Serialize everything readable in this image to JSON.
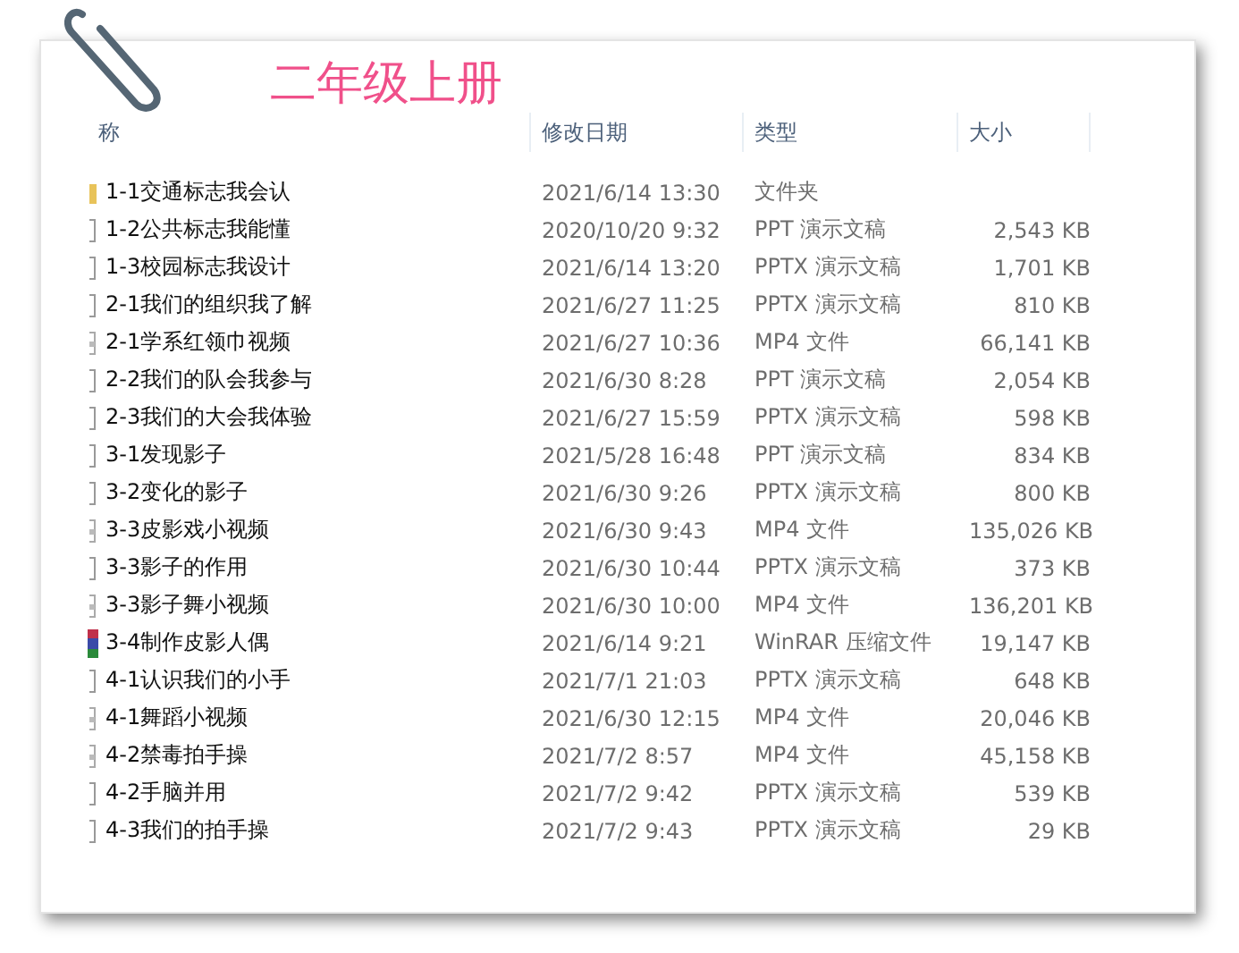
{
  "title": "二年级上册",
  "columns": [
    "称",
    "修改日期",
    "类型",
    "大小"
  ],
  "rows": [
    {
      "kind": "folder",
      "name": "1-1交通标志我会认",
      "date": "2021/6/14 13:30",
      "type": "文件夹",
      "size": ""
    },
    {
      "kind": "doc",
      "name": "1-2公共标志我能懂",
      "date": "2020/10/20 9:32",
      "type": "PPT 演示文稿",
      "size": "2,543 KB"
    },
    {
      "kind": "doc",
      "name": "1-3校园标志我设计",
      "date": "2021/6/14 13:20",
      "type": "PPTX 演示文稿",
      "size": "1,701 KB"
    },
    {
      "kind": "doc",
      "name": "2-1我们的组织我了解",
      "date": "2021/6/27 11:25",
      "type": "PPTX 演示文稿",
      "size": "810 KB"
    },
    {
      "kind": "video",
      "name": "2-1学系红领巾视频",
      "date": "2021/6/27 10:36",
      "type": "MP4 文件",
      "size": "66,141 KB"
    },
    {
      "kind": "doc",
      "name": "2-2我们的队会我参与",
      "date": "2021/6/30 8:28",
      "type": "PPT 演示文稿",
      "size": "2,054 KB"
    },
    {
      "kind": "doc",
      "name": "2-3我们的大会我体验",
      "date": "2021/6/27 15:59",
      "type": "PPTX 演示文稿",
      "size": "598 KB"
    },
    {
      "kind": "doc",
      "name": "3-1发现影子",
      "date": "2021/5/28 16:48",
      "type": "PPT 演示文稿",
      "size": "834 KB"
    },
    {
      "kind": "doc",
      "name": "3-2变化的影子",
      "date": "2021/6/30 9:26",
      "type": "PPTX 演示文稿",
      "size": "800 KB"
    },
    {
      "kind": "video",
      "name": "3-3皮影戏小视频",
      "date": "2021/6/30 9:43",
      "type": "MP4 文件",
      "size": "135,026 KB"
    },
    {
      "kind": "doc",
      "name": "3-3影子的作用",
      "date": "2021/6/30 10:44",
      "type": "PPTX 演示文稿",
      "size": "373 KB"
    },
    {
      "kind": "video",
      "name": "3-3影子舞小视频",
      "date": "2021/6/30 10:00",
      "type": "MP4 文件",
      "size": "136,201 KB"
    },
    {
      "kind": "archive",
      "name": "3-4制作皮影人偶",
      "date": "2021/6/14 9:21",
      "type": "WinRAR 压缩文件",
      "size": "19,147 KB"
    },
    {
      "kind": "doc",
      "name": "4-1认识我们的小手",
      "date": "2021/7/1 21:03",
      "type": "PPTX 演示文稿",
      "size": "648 KB"
    },
    {
      "kind": "video",
      "name": "4-1舞蹈小视频",
      "date": "2021/6/30 12:15",
      "type": "MP4 文件",
      "size": "20,046 KB"
    },
    {
      "kind": "video",
      "name": "4-2禁毒拍手操",
      "date": "2021/7/2 8:57",
      "type": "MP4 文件",
      "size": "45,158 KB"
    },
    {
      "kind": "doc",
      "name": "4-2手脑并用",
      "date": "2021/7/2 9:42",
      "type": "PPTX 演示文稿",
      "size": "539 KB"
    },
    {
      "kind": "doc",
      "name": "4-3我们的拍手操",
      "date": "2021/7/2 9:43",
      "type": "PPTX 演示文稿",
      "size": "29 KB"
    }
  ]
}
